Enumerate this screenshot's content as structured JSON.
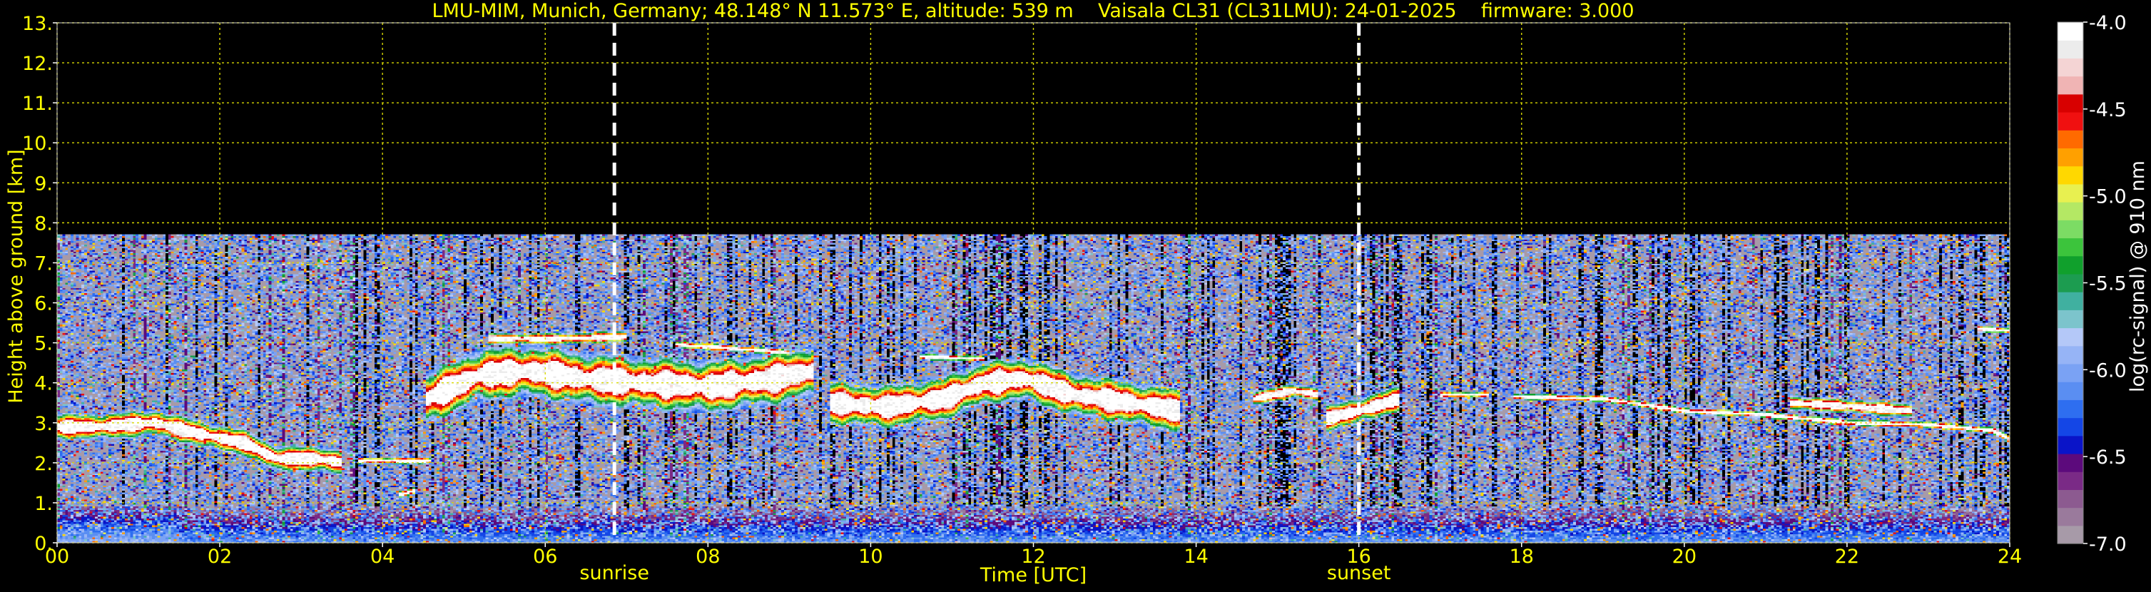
{
  "chart_data": {
    "type": "heatmap",
    "title": "LMU-MIM, Munich, Germany; 48.148° N 11.573° E, altitude: 539 m    Vaisala CL31 (CL31LMU): 24-01-2025    firmware: 3.000",
    "xlabel": "Time [UTC]",
    "ylabel": "Height above ground [km]",
    "xlim": [
      0,
      24
    ],
    "ylim": [
      0,
      13
    ],
    "x_ticks": [
      0,
      2,
      4,
      6,
      8,
      10,
      12,
      14,
      16,
      18,
      20,
      22,
      24
    ],
    "x_tick_labels": [
      "00",
      "02",
      "04",
      "06",
      "08",
      "10",
      "12",
      "14",
      "16",
      "18",
      "20",
      "22",
      "24"
    ],
    "y_ticks": [
      0,
      1,
      2,
      3,
      4,
      5,
      6,
      7,
      8,
      9,
      10,
      11,
      12,
      13
    ],
    "y_tick_labels": [
      "0.",
      "1.",
      "2.",
      "3.",
      "4.",
      "5.",
      "6.",
      "7.",
      "8.",
      "9.",
      "10.",
      "11.",
      "12.",
      "13."
    ],
    "grid": true,
    "signal_ceiling_km": 7.7,
    "markers": [
      {
        "label": "sunrise",
        "x": 6.85
      },
      {
        "label": "sunset",
        "x": 16.0
      }
    ],
    "colorbar": {
      "label": "log(rc-signal) @ 910 nm",
      "range": [
        -7.0,
        -4.0
      ],
      "ticks": [
        -7.0,
        -6.5,
        -6.0,
        -5.5,
        -5.0,
        -4.5,
        -4.0
      ],
      "tick_labels": [
        "-7.0",
        "-6.5",
        "-6.0",
        "-5.5",
        "-5.0",
        "-4.5",
        "-4.0"
      ],
      "colors": [
        "#a79aa8",
        "#9a7a9c",
        "#8c5a90",
        "#7a2a86",
        "#5c0a7c",
        "#0a14c8",
        "#1446e6",
        "#2e6ef0",
        "#5a8ef2",
        "#7aa2f4",
        "#96b4f6",
        "#b4c8f8",
        "#7cc4cc",
        "#40b0a0",
        "#1c9c50",
        "#10a02c",
        "#3cc43c",
        "#7cdc64",
        "#b4e864",
        "#e8f050",
        "#ffd800",
        "#ffa000",
        "#ff6a00",
        "#f01010",
        "#d80000",
        "#f0b4b4",
        "#f4d4d4",
        "#ececec",
        "#ffffff"
      ]
    },
    "features": [
      {
        "kind": "surface_aerosol",
        "x0": 0,
        "x1": 24,
        "z_top_km": 0.9,
        "level_low": -6.1,
        "level_high": -6.9
      },
      {
        "kind": "cloud_layer",
        "points": [
          [
            0.0,
            2.9
          ],
          [
            0.5,
            2.9
          ],
          [
            1.2,
            3.0
          ],
          [
            1.8,
            2.7
          ],
          [
            2.3,
            2.5
          ],
          [
            2.7,
            2.1
          ],
          [
            3.2,
            2.1
          ],
          [
            3.5,
            2.0
          ]
        ],
        "thickness_km": 0.45
      },
      {
        "kind": "cloud_layer",
        "points": [
          [
            3.7,
            2.05
          ],
          [
            4.6,
            2.05
          ]
        ],
        "thickness_km": 0.12
      },
      {
        "kind": "cloud_layer",
        "points": [
          [
            4.2,
            1.2
          ],
          [
            4.4,
            1.3
          ]
        ],
        "thickness_km": 0.12
      },
      {
        "kind": "cloud_layer",
        "points": [
          [
            4.55,
            3.6
          ],
          [
            5.2,
            4.2
          ],
          [
            5.8,
            4.3
          ],
          [
            6.5,
            4.1
          ],
          [
            7.2,
            4.0
          ],
          [
            8.0,
            3.9
          ],
          [
            8.8,
            4.1
          ],
          [
            9.3,
            4.3
          ]
        ],
        "thickness_km": 0.9
      },
      {
        "kind": "cloud_layer",
        "points": [
          [
            5.3,
            5.1
          ],
          [
            6.2,
            5.1
          ],
          [
            7.0,
            5.15
          ]
        ],
        "thickness_km": 0.2
      },
      {
        "kind": "cloud_layer",
        "points": [
          [
            7.6,
            4.95
          ],
          [
            8.4,
            4.85
          ],
          [
            9.0,
            4.75
          ]
        ],
        "thickness_km": 0.12
      },
      {
        "kind": "cloud_layer",
        "points": [
          [
            9.5,
            3.5
          ],
          [
            10.2,
            3.4
          ],
          [
            10.9,
            3.6
          ],
          [
            11.4,
            4.0
          ],
          [
            11.9,
            4.1
          ],
          [
            12.5,
            3.7
          ],
          [
            13.2,
            3.5
          ],
          [
            13.8,
            3.3
          ]
        ],
        "thickness_km": 0.75
      },
      {
        "kind": "cloud_layer",
        "points": [
          [
            10.6,
            4.65
          ],
          [
            11.4,
            4.6
          ]
        ],
        "thickness_km": 0.1
      },
      {
        "kind": "cloud_layer",
        "points": [
          [
            14.7,
            3.6
          ],
          [
            15.2,
            3.8
          ],
          [
            15.5,
            3.7
          ]
        ],
        "thickness_km": 0.25
      },
      {
        "kind": "cloud_layer",
        "points": [
          [
            15.6,
            3.1
          ],
          [
            16.0,
            3.3
          ],
          [
            16.5,
            3.6
          ]
        ],
        "thickness_km": 0.45
      },
      {
        "kind": "cloud_layer",
        "points": [
          [
            17.0,
            3.7
          ],
          [
            17.6,
            3.7
          ]
        ],
        "thickness_km": 0.1
      },
      {
        "kind": "cloud_layer",
        "points": [
          [
            17.9,
            3.65
          ],
          [
            19.0,
            3.6
          ],
          [
            20.0,
            3.3
          ],
          [
            21.0,
            3.2
          ],
          [
            22.0,
            3.0
          ],
          [
            23.0,
            2.95
          ],
          [
            23.8,
            2.8
          ],
          [
            24.0,
            2.6
          ]
        ],
        "thickness_km": 0.12
      },
      {
        "kind": "cloud_layer",
        "points": [
          [
            21.3,
            3.5
          ],
          [
            22.1,
            3.4
          ],
          [
            22.8,
            3.3
          ]
        ],
        "thickness_km": 0.25
      },
      {
        "kind": "cloud_layer",
        "points": [
          [
            23.6,
            5.35
          ],
          [
            24.0,
            5.3
          ]
        ],
        "thickness_km": 0.12
      }
    ]
  }
}
